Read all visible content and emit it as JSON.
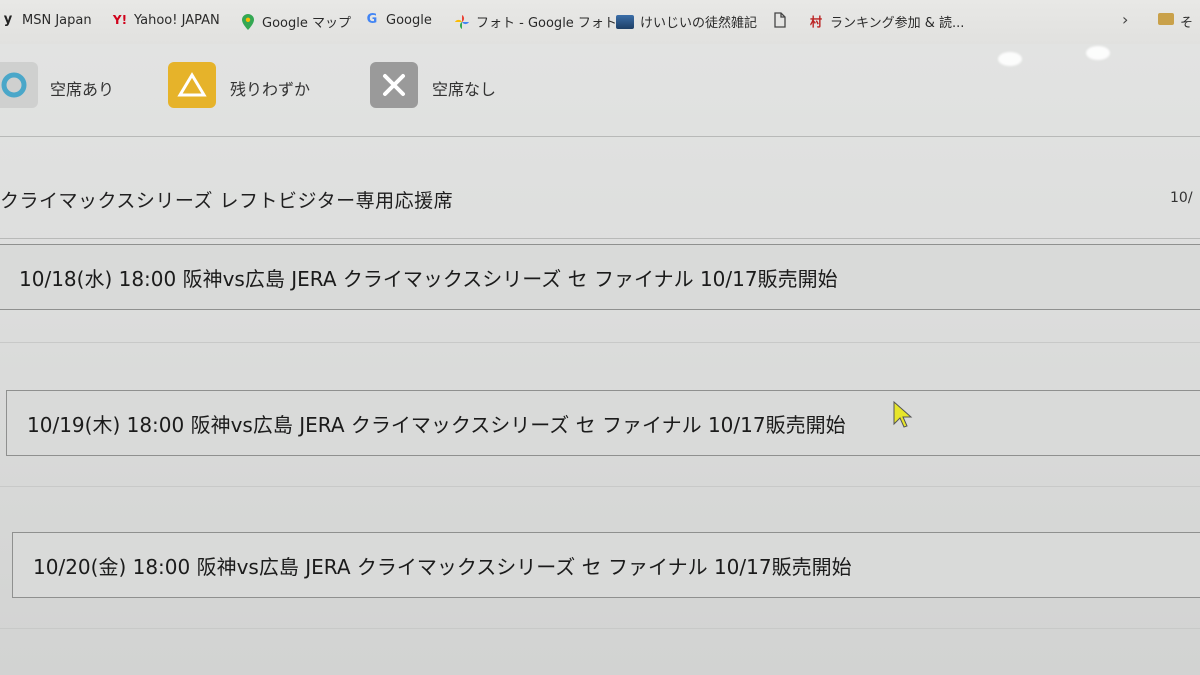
{
  "bookmarks": {
    "items": [
      {
        "label": "MSN Japan",
        "icon": "msn-icon"
      },
      {
        "label": "Yahoo! JAPAN",
        "icon": "yahoo-icon"
      },
      {
        "label": "Google マップ",
        "icon": "maps-pin-icon"
      },
      {
        "label": "Google",
        "icon": "google-g-icon"
      },
      {
        "label": "フォト - Google フォト",
        "icon": "photos-pinwheel-icon"
      },
      {
        "label": "けいじいの徒然雑記",
        "icon": "blog-thumbnail-icon"
      },
      {
        "label": "",
        "icon": "document-icon"
      },
      {
        "label": "ランキング参加 & 読...",
        "icon": "mura-icon"
      }
    ],
    "more": "›",
    "folder_label": "そ"
  },
  "legend": {
    "available": "空席あり",
    "few_left": "残りわずか",
    "sold_out": "空席なし"
  },
  "section": {
    "title": "クライマックスシリーズ レフトビジター専用応援席",
    "date_partial": "10/"
  },
  "events": [
    {
      "label": "10/18(水) 18:00 阪神vs広島 JERA クライマックスシリーズ セ ファイナル 10/17販売開始"
    },
    {
      "label": "10/19(木) 18:00 阪神vs広島 JERA クライマックスシリーズ セ ファイナル 10/17販売開始"
    },
    {
      "label": "10/20(金) 18:00 阪神vs広島 JERA クライマックスシリーズ セ ファイナル 10/17販売開始"
    }
  ],
  "colors": {
    "available": "#4aa7c9",
    "few_left": "#e6b32a",
    "sold_out": "#9a9a9a",
    "cursor": "#e7e52a"
  }
}
